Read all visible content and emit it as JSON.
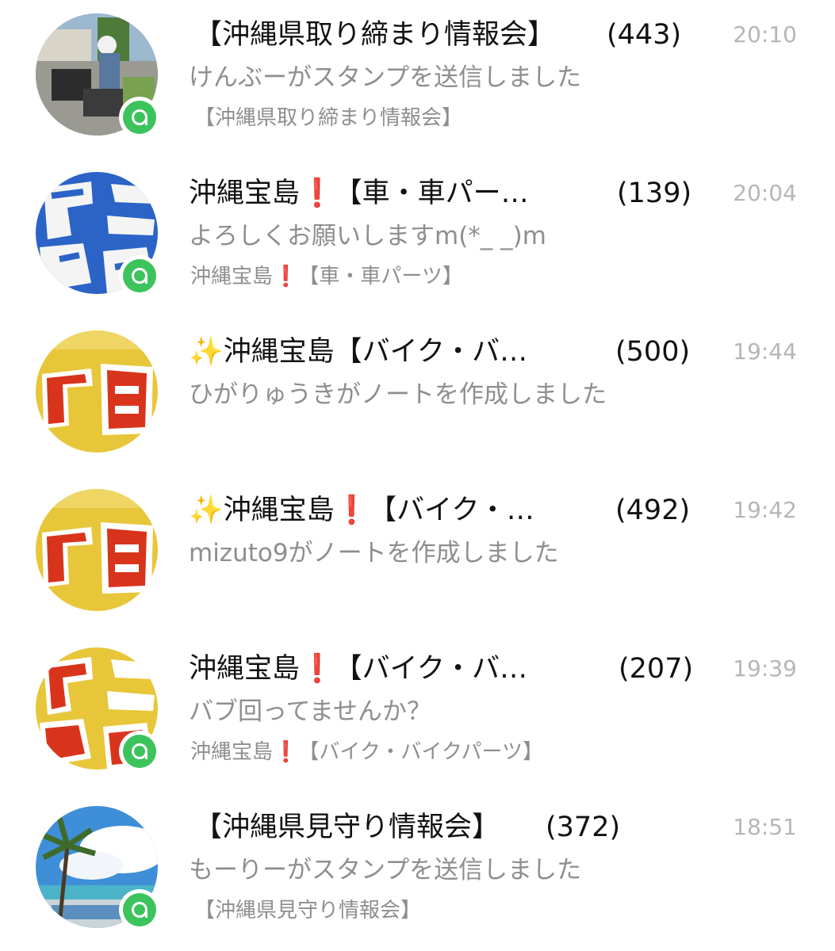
{
  "chats": [
    {
      "title": "【沖縄県取り締まり情報会】",
      "count": "(443)",
      "time": "20:10",
      "preview": "けんぶーがスタンプを送信しました",
      "subtitle": "【沖縄県取り締まり情報会】",
      "avatar_icon": "police-motorcycle-photo"
    },
    {
      "title": "沖縄宝島❗【車・車パー…",
      "count": "(139)",
      "time": "20:04",
      "preview": "よろしくお願いしますm(*_ _)m",
      "subtitle": "沖縄宝島❗【車・車パーツ】",
      "avatar_icon": "takarajima-blue-logo"
    },
    {
      "title": "✨沖縄宝島【バイク・バ…",
      "count": "(500)",
      "time": "19:44",
      "preview": "ひがりゅうきがノートを作成しました",
      "subtitle": "",
      "avatar_icon": "takarajima-yellow-logo"
    },
    {
      "title": "✨沖縄宝島❗【バイク・…",
      "count": "(492)",
      "time": "19:42",
      "preview": "mizuto9がノートを作成しました",
      "subtitle": "",
      "avatar_icon": "takarajima-yellow-logo"
    },
    {
      "title": "沖縄宝島❗【バイク・バ…",
      "count": "(207)",
      "time": "19:39",
      "preview": "バブ回ってませんか？",
      "subtitle": "沖縄宝島❗【バイク・バイクパーツ】",
      "avatar_icon": "takarajima-yellow-red-logo"
    },
    {
      "title": "【沖縄県見守り情報会】",
      "count": "(372)",
      "time": "18:51",
      "preview": "もーりーがスタンプを送信しました",
      "subtitle": "【沖縄県見守り情報会】",
      "avatar_icon": "beach-sky-photo"
    }
  ],
  "colors": {
    "badge_green": "#3dc35b",
    "text_primary": "#111111",
    "text_secondary": "#8e8e8e",
    "time_gray": "#b6b6b6",
    "logo_yellow": "#e8c63a",
    "logo_red": "#d8341c",
    "logo_blue": "#2b63c7"
  }
}
